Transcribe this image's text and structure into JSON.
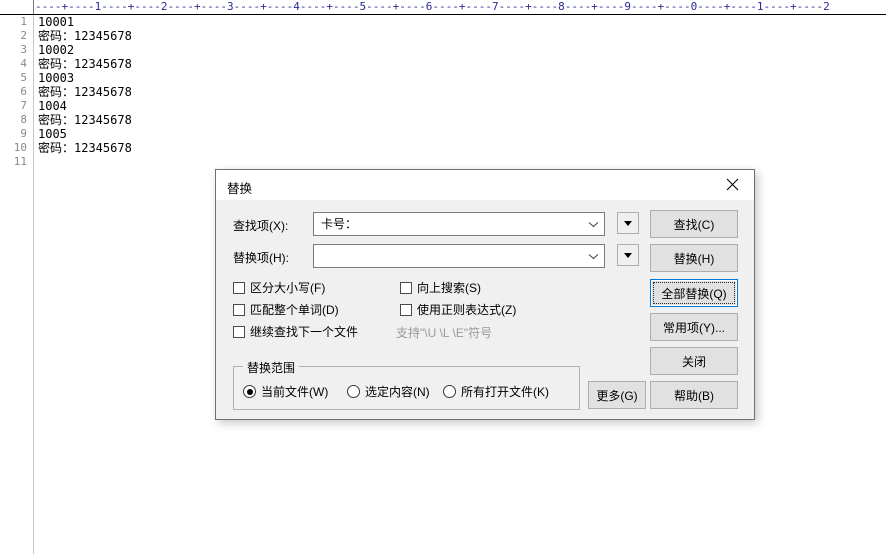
{
  "editor": {
    "ruler_marks": "----+----1----+----2----+----3----+----4----+----5----+----6----+----7----+----8----+----9----+----0----+----1----+----2",
    "line_numbers": [
      "1",
      "2",
      "3",
      "4",
      "5",
      "6",
      "7",
      "8",
      "9",
      "10",
      "11"
    ],
    "lines": [
      "10001",
      "密码：12345678",
      "10002",
      "密码：12345678",
      "10003",
      "密码：12345678",
      "1004",
      "密码：12345678",
      "1005",
      "密码：12345678",
      ""
    ]
  },
  "dialog": {
    "title": "替换",
    "close_icon": "close-icon",
    "fields": {
      "find_label": "查找项(X):",
      "find_value": "卡号：",
      "find_placeholder": "",
      "replace_label": "替换项(H):",
      "replace_value": "",
      "replace_placeholder": "",
      "dropdown_icon": "triangle-down-icon",
      "chevron_icon": "chevron-down-icon"
    },
    "checkboxes": [
      {
        "label": "区分大小写(F)",
        "checked": false
      },
      {
        "label": "匹配整个单词(D)",
        "checked": false
      },
      {
        "label": "继续查找下一个文件",
        "checked": false
      },
      {
        "label": "向上搜索(S)",
        "checked": false
      },
      {
        "label": "使用正则表达式(Z)",
        "checked": false
      }
    ],
    "regex_hint": "支持\"\\U \\L \\E\"符号",
    "scope": {
      "legend": "替换范围",
      "options": [
        {
          "label": "当前文件(W)",
          "selected": true
        },
        {
          "label": "选定内容(N)",
          "selected": false
        },
        {
          "label": "所有打开文件(K)",
          "selected": false
        }
      ]
    },
    "buttons": {
      "find": "查找(C)",
      "replace": "替换(H)",
      "replace_all": "全部替换(Q)",
      "common": "常用项(Y)...",
      "close": "关闭",
      "more": "更多(G)",
      "help": "帮助(B)"
    },
    "focused_button": "全部替换(Q)",
    "accent_color": "#0078d7"
  }
}
